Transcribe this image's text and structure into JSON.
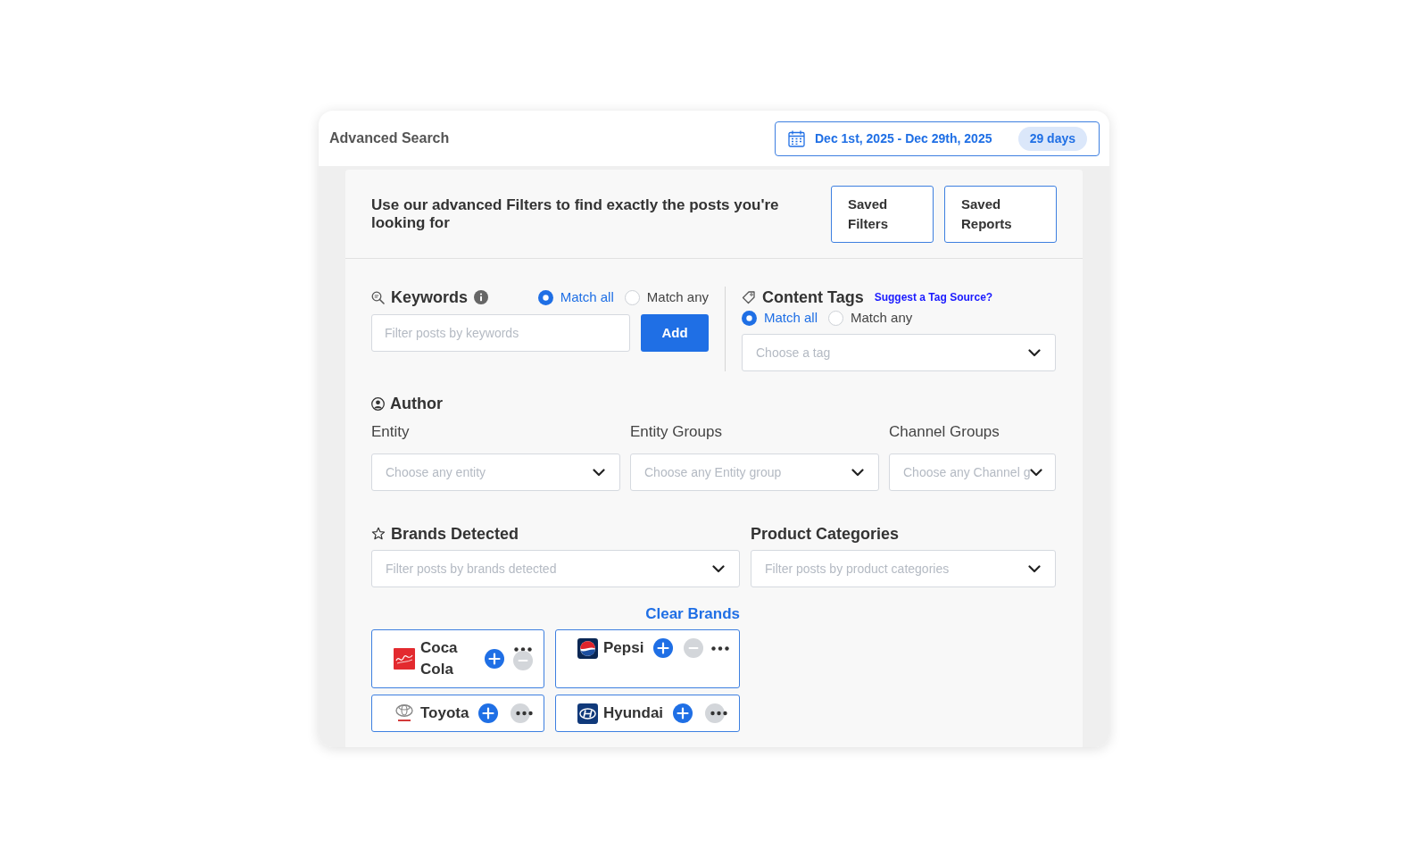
{
  "header": {
    "title": "Advanced Search",
    "date_range": {
      "label": "Dec 1st, 2025 - Dec 29th, 2025",
      "badge": "29 days"
    }
  },
  "intro": {
    "text": "Use our advanced Filters to find exactly the posts you're looking for",
    "buttons": [
      "Saved Filters",
      "Saved Reports"
    ]
  },
  "keywords": {
    "title": "Keywords",
    "match_options": [
      {
        "label": "Match all",
        "selected": true
      },
      {
        "label": "Match any",
        "selected": false
      }
    ],
    "input": {
      "placeholder": "Filter posts by keywords"
    },
    "add_button": "Add"
  },
  "content_tags": {
    "title": "Content Tags",
    "link": "Suggest a Tag Source?",
    "match_options": [
      {
        "label": "Match all",
        "selected": true
      },
      {
        "label": "Match any",
        "selected": false
      }
    ],
    "select": {
      "placeholder": "Choose a tag"
    }
  },
  "author": {
    "title": "Author",
    "fields": [
      {
        "label": "Entity",
        "placeholder": "Choose any entity"
      },
      {
        "label": "Entity Groups",
        "placeholder": "Choose any Entity group"
      },
      {
        "label": "Channel Groups",
        "placeholder": "Choose any Channel g"
      }
    ]
  },
  "brands_detected": {
    "title": "Brands Detected",
    "select": {
      "placeholder": "Filter posts by brands detected"
    },
    "clear_link": "Clear Brands",
    "brands": [
      {
        "name": "Coca Cola",
        "kind": "stacked"
      },
      {
        "name": "Pepsi",
        "kind": "inline"
      },
      {
        "name": "Toyota",
        "kind": "compact"
      },
      {
        "name": "Hyundai",
        "kind": "compact"
      }
    ]
  },
  "product_categories": {
    "title": "Product Categories",
    "select": {
      "placeholder": "Filter posts by product categories"
    }
  }
}
